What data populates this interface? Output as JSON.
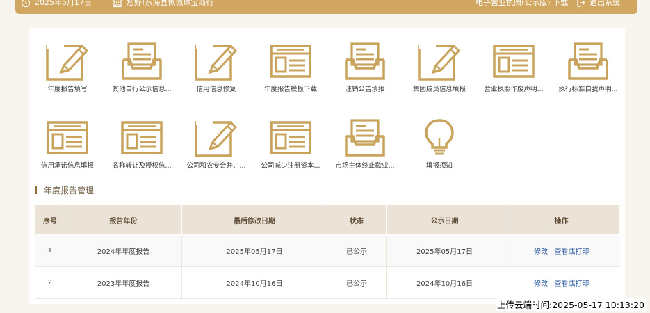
{
  "topbar": {
    "date": "2025年5月17日",
    "greeting": "您好!东海县佩佩珠宝商行",
    "license_download": "电子营业执照(公示版) 下载",
    "logout": "退出系统"
  },
  "tiles_row1": [
    {
      "label": "年度报告填写",
      "icon": "pencil-edit-icon"
    },
    {
      "label": "其他自行公示信息...",
      "icon": "inbox-tray-icon"
    },
    {
      "label": "信用信息修复",
      "icon": "pencil-edit-icon"
    },
    {
      "label": "年度报告模板下载",
      "icon": "form-template-icon"
    },
    {
      "label": "注销公告填报",
      "icon": "inbox-tray-icon"
    },
    {
      "label": "集团成员信息填报",
      "icon": "pencil-edit-icon"
    },
    {
      "label": "营业执照作废声明...",
      "icon": "form-template-icon"
    },
    {
      "label": "执行标准自我声明...",
      "icon": "inbox-tray-icon"
    }
  ],
  "tiles_row2": [
    {
      "label": "信用承诺信息填报",
      "icon": "form-template-icon"
    },
    {
      "label": "名称转让及授权信...",
      "icon": "form-template-icon"
    },
    {
      "label": "公司和农专合并、...",
      "icon": "pencil-edit-icon"
    },
    {
      "label": "公司减少注册资本...",
      "icon": "form-template-icon"
    },
    {
      "label": "市场主体终止歇业...",
      "icon": "inbox-tray-icon"
    },
    {
      "label": "填报须知",
      "icon": "lightbulb-icon"
    }
  ],
  "section": {
    "title": "年度报告管理"
  },
  "table": {
    "headers": [
      "序号",
      "报告年份",
      "最后修改日期",
      "状态",
      "公示日期",
      "操作"
    ],
    "rows": [
      {
        "no": "1",
        "year": "2024年年度报告",
        "modified": "2025年05月17日",
        "status": "已公示",
        "public_date": "2025年05月17日",
        "edit": "修改",
        "view": "查看或打印"
      },
      {
        "no": "2",
        "year": "2023年年度报告",
        "modified": "2024年10月16日",
        "status": "已公示",
        "public_date": "2024年10月16日",
        "edit": "修改",
        "view": "查看或打印"
      }
    ]
  },
  "upload_time": "上传云端时间:2025-05-17 10:13:20",
  "colors": {
    "accent": "#d0a660",
    "icon": "#c9a35c",
    "header_bg": "#ece3d8",
    "link": "#2c5c9e"
  }
}
